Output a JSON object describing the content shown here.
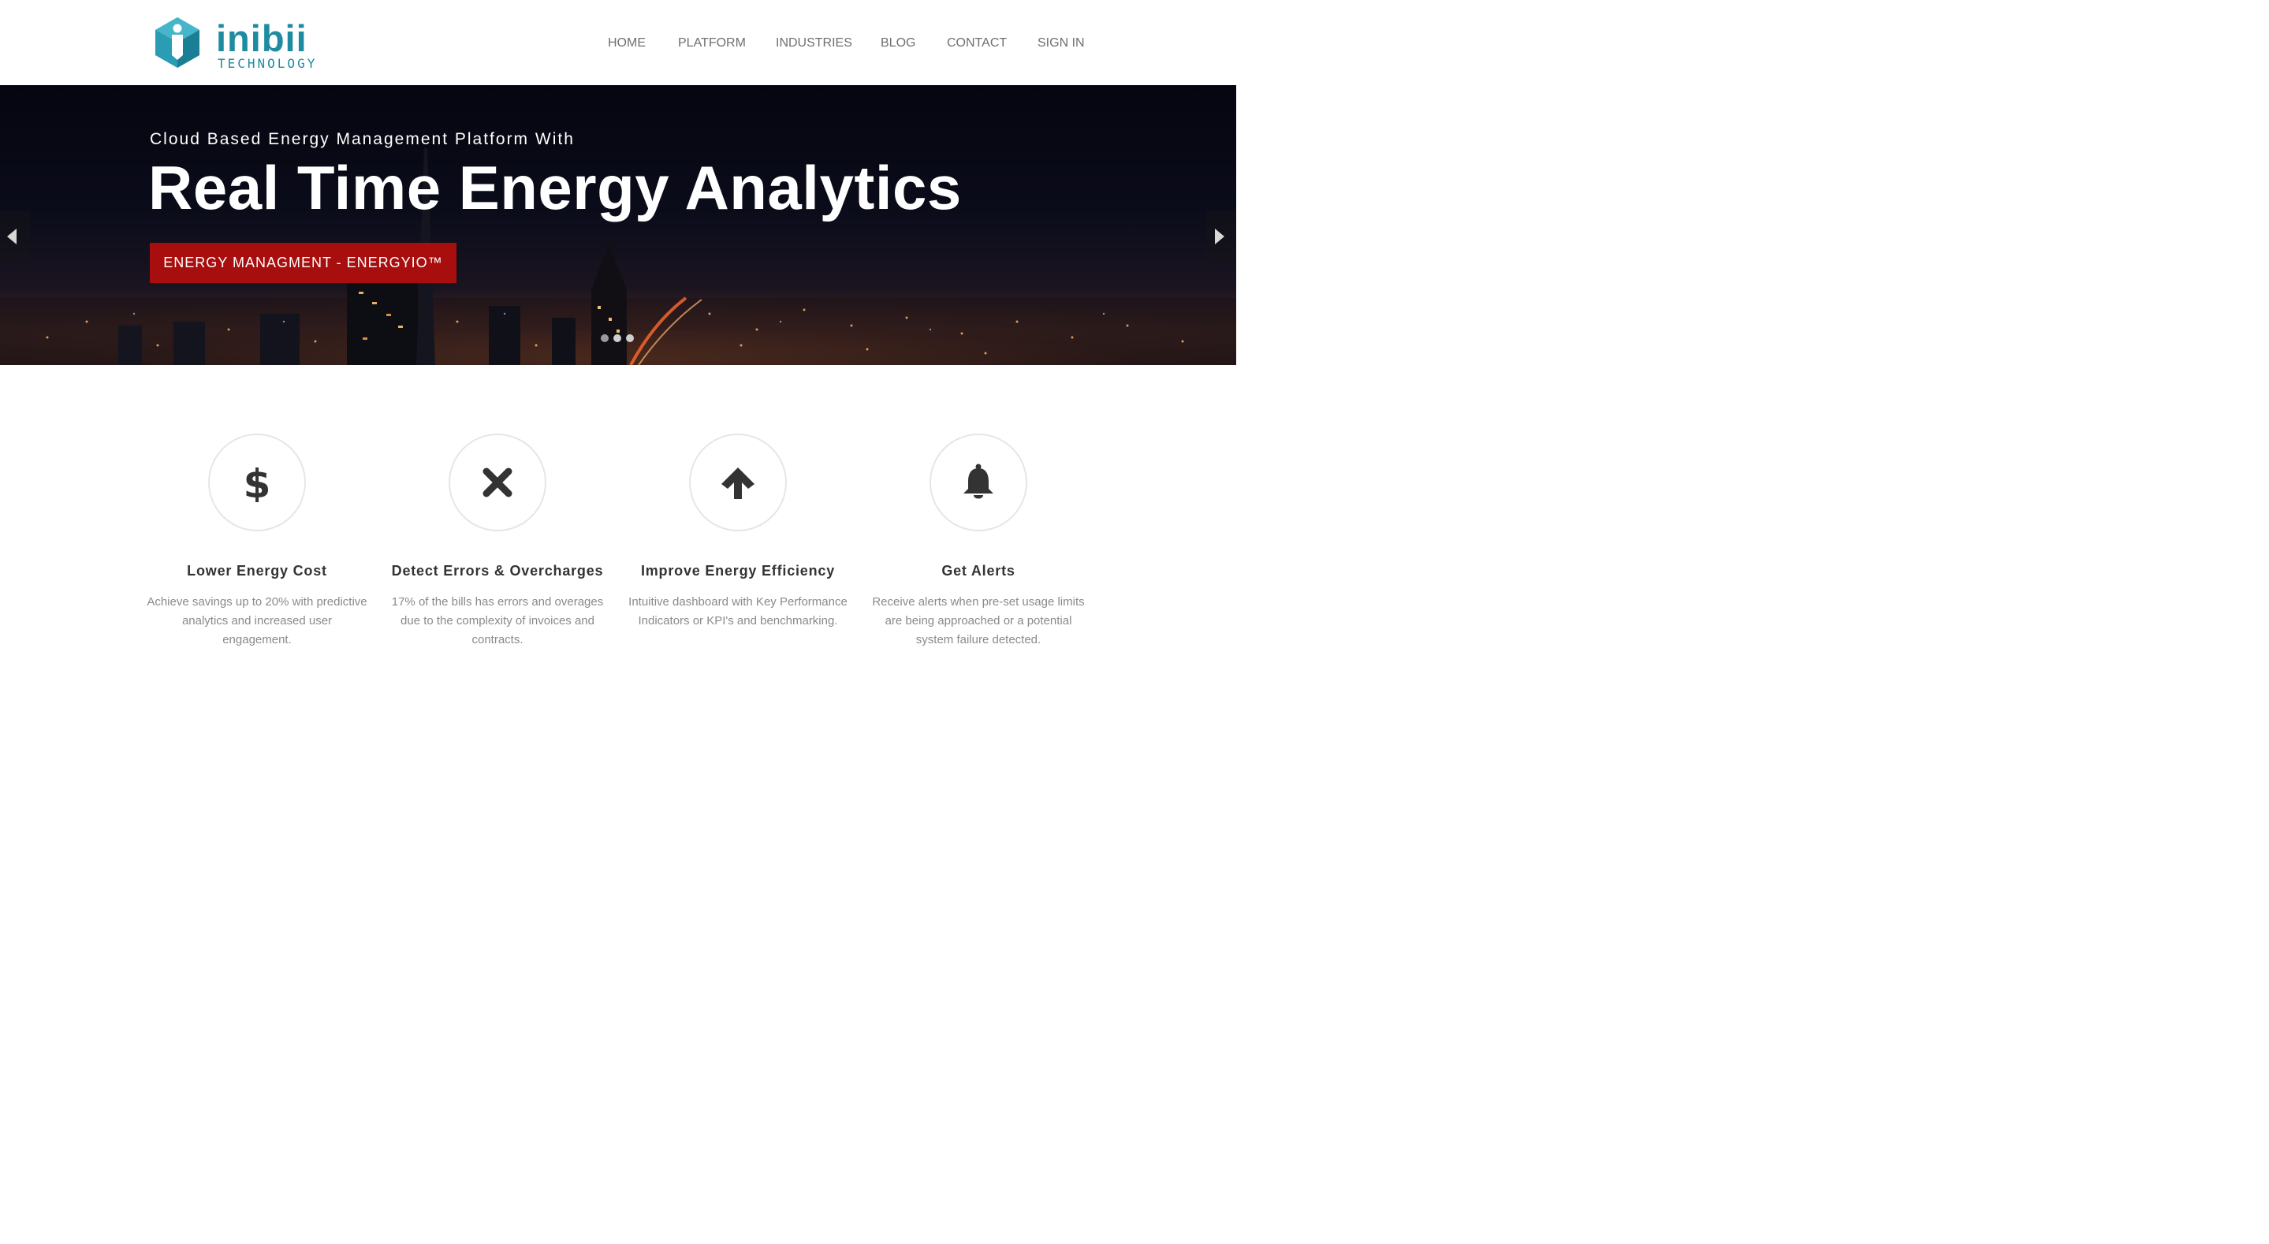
{
  "brand": {
    "name": "inibii",
    "tagline": "TECHNOLOGY",
    "color": "#1e8ba1"
  },
  "nav": {
    "items": [
      {
        "label": "HOME"
      },
      {
        "label": "PLATFORM"
      },
      {
        "label": "INDUSTRIES"
      },
      {
        "label": "BLOG"
      },
      {
        "label": "CONTACT"
      },
      {
        "label": "SIGN IN"
      }
    ]
  },
  "hero": {
    "subtitle": "Cloud Based Energy Management Platform With",
    "title": "Real Time Energy Analytics",
    "cta_label": "ENERGY MANAGMENT - ENERGYIO™",
    "cta_color": "#a80e0e",
    "prev_icon": "caret-left-icon",
    "next_icon": "caret-right-icon",
    "slide_count": 3
  },
  "features": [
    {
      "icon": "dollar-icon",
      "title": "Lower Energy Cost",
      "description": "Achieve savings up to 20% with predictive analytics and increased user engagement."
    },
    {
      "icon": "close-x-icon",
      "title": "Detect Errors & Overcharges",
      "description": "17% of the bills has errors and overages due to the complexity of invoices and contracts."
    },
    {
      "icon": "arrow-up-icon",
      "title": "Improve Energy Efficiency",
      "description": "Intuitive dashboard with Key Performance Indicators or KPI's and benchmarking."
    },
    {
      "icon": "bell-icon",
      "title": "Get Alerts",
      "description": "Receive alerts when pre-set usage limits are being approached or a potential system failure detected."
    }
  ]
}
